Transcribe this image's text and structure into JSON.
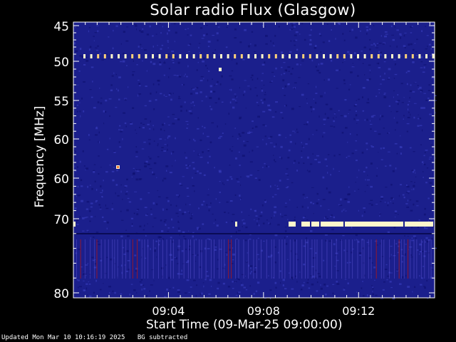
{
  "chart_data": {
    "type": "heatmap",
    "title": "Solar radio Flux (Glasgow)",
    "ylabel": "Frequency [MHz]",
    "xlabel": "Start Time (09-Mar-25 09:00:00)",
    "y_ticks": [
      "45",
      "50",
      "55",
      "60",
      "60",
      "70",
      "80"
    ],
    "x_ticks": [
      "09:04",
      "09:08",
      "09:12"
    ],
    "x_range_minutes": [
      0,
      15.2
    ],
    "colors": {
      "background": "#1b1f8c",
      "noise_dark": "#0e0f6e",
      "noise_light": "#3a3fc0",
      "hot": "#fff6cc",
      "warm": "#ff7a3a",
      "red_line": "#b01616"
    },
    "features": [
      {
        "name": "dashed line near 50 MHz",
        "frequency_label": "50",
        "pattern": "periodic bright dots"
      },
      {
        "name": "persistent emission near 70 MHz",
        "frequency_label": "70",
        "start_minute": 9.1,
        "end_minute": 15.2
      },
      {
        "name": "isolated burst",
        "frequency_label": "50",
        "minute": 6.1
      },
      {
        "name": "isolated burst",
        "frequency_label": "60",
        "minute": 1.8
      }
    ]
  },
  "footer": {
    "updated": "Updated Mon Mar 10 10:16:19 2025",
    "note": "BG subtracted"
  }
}
